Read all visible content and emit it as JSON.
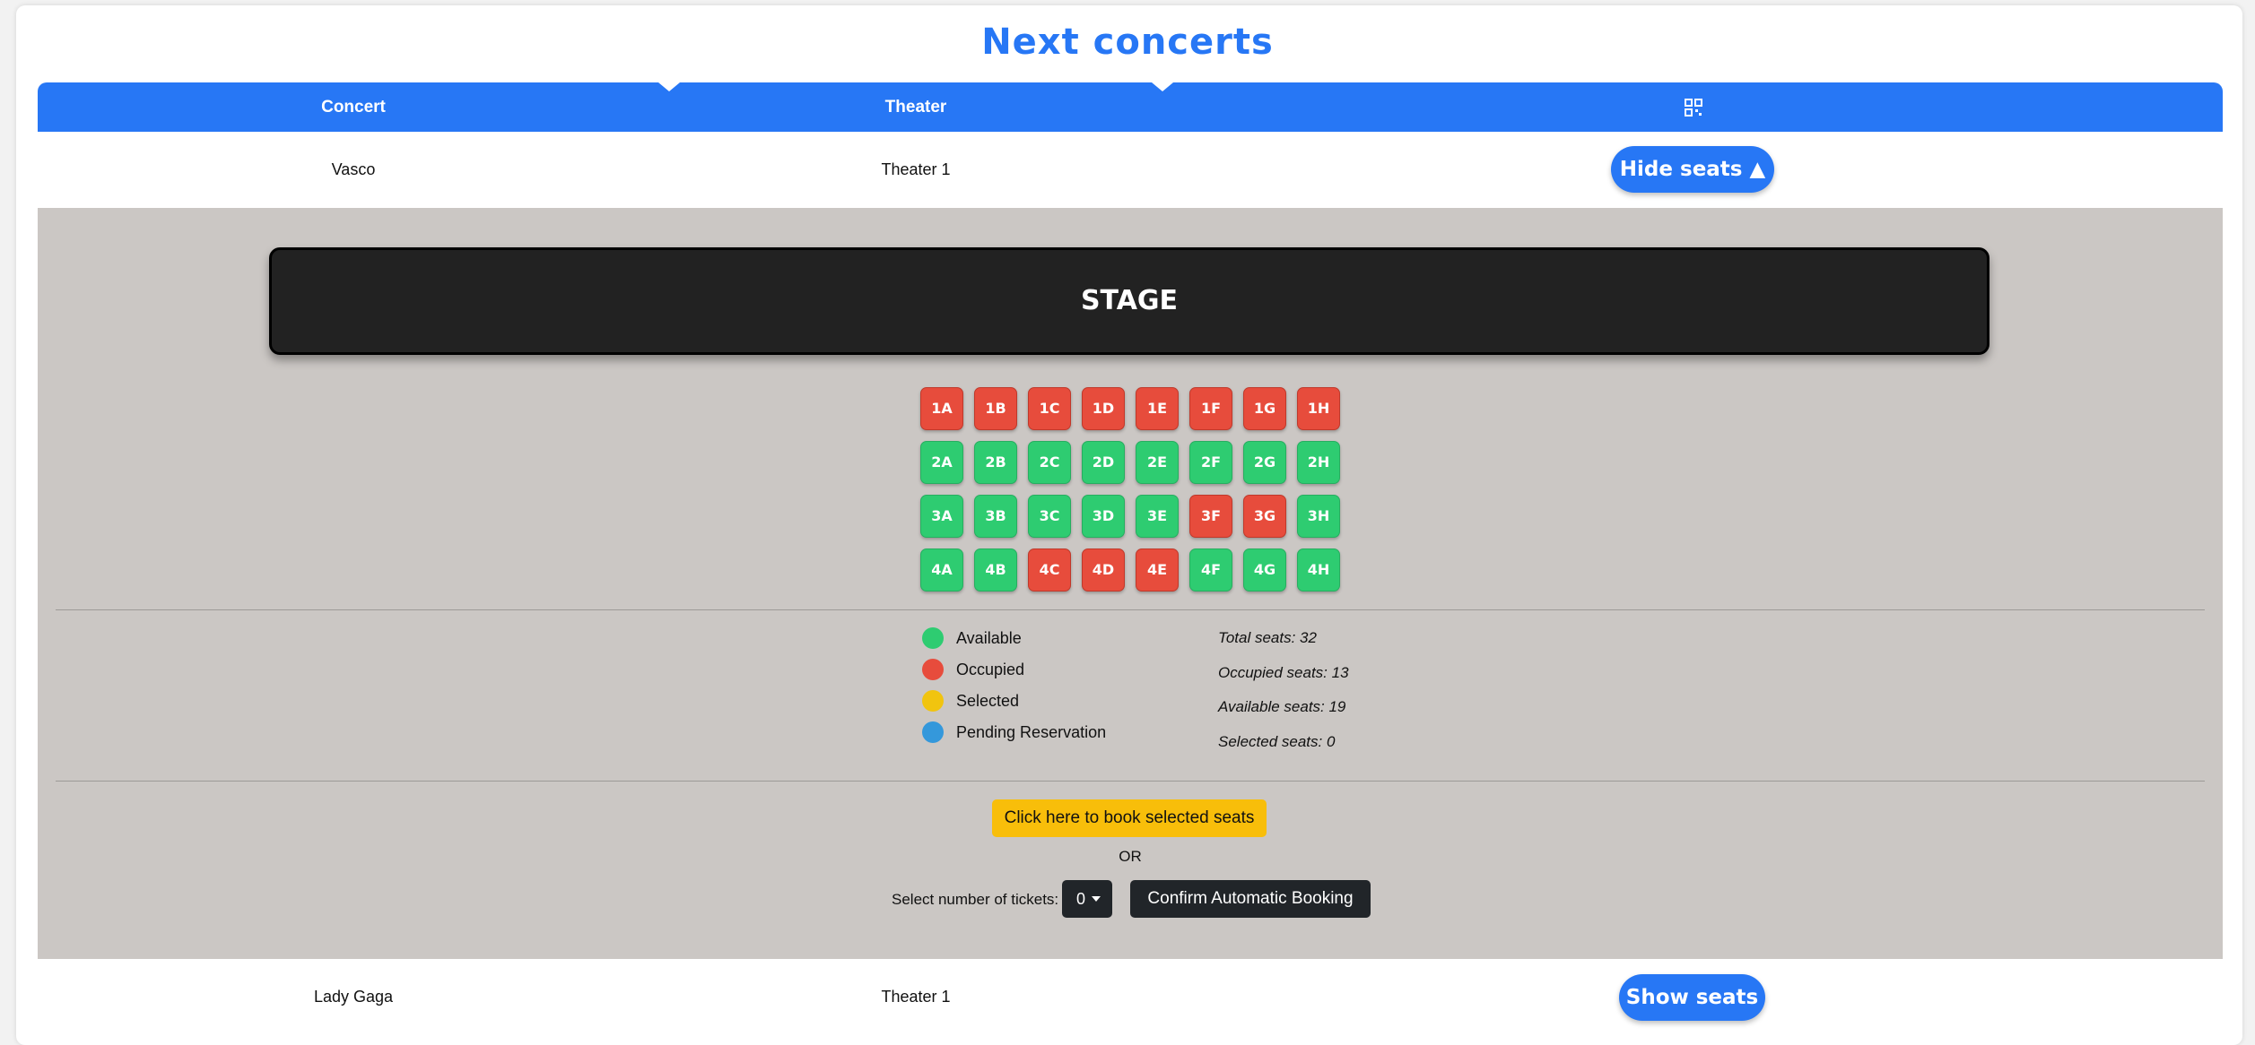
{
  "page": {
    "title": "Next concerts"
  },
  "table": {
    "headers": {
      "concert": "Concert",
      "theater": "Theater",
      "actions_icon": "grid-icon"
    },
    "rows": [
      {
        "concert": "Vasco",
        "theater": "Theater 1",
        "action": "Hide seats ▲",
        "expanded": true
      },
      {
        "concert": "Lady Gaga",
        "theater": "Theater 1",
        "action": "Show seats",
        "expanded": false
      }
    ]
  },
  "seatmap": {
    "stage_label": "STAGE",
    "rows": [
      [
        {
          "id": "1A",
          "status": "occupied"
        },
        {
          "id": "1B",
          "status": "occupied"
        },
        {
          "id": "1C",
          "status": "occupied"
        },
        {
          "id": "1D",
          "status": "occupied"
        },
        {
          "id": "1E",
          "status": "occupied"
        },
        {
          "id": "1F",
          "status": "occupied"
        },
        {
          "id": "1G",
          "status": "occupied"
        },
        {
          "id": "1H",
          "status": "occupied"
        }
      ],
      [
        {
          "id": "2A",
          "status": "available"
        },
        {
          "id": "2B",
          "status": "available"
        },
        {
          "id": "2C",
          "status": "available"
        },
        {
          "id": "2D",
          "status": "available"
        },
        {
          "id": "2E",
          "status": "available"
        },
        {
          "id": "2F",
          "status": "available"
        },
        {
          "id": "2G",
          "status": "available"
        },
        {
          "id": "2H",
          "status": "available"
        }
      ],
      [
        {
          "id": "3A",
          "status": "available"
        },
        {
          "id": "3B",
          "status": "available"
        },
        {
          "id": "3C",
          "status": "available"
        },
        {
          "id": "3D",
          "status": "available"
        },
        {
          "id": "3E",
          "status": "available"
        },
        {
          "id": "3F",
          "status": "occupied"
        },
        {
          "id": "3G",
          "status": "occupied"
        },
        {
          "id": "3H",
          "status": "available"
        }
      ],
      [
        {
          "id": "4A",
          "status": "available"
        },
        {
          "id": "4B",
          "status": "available"
        },
        {
          "id": "4C",
          "status": "occupied"
        },
        {
          "id": "4D",
          "status": "occupied"
        },
        {
          "id": "4E",
          "status": "occupied"
        },
        {
          "id": "4F",
          "status": "available"
        },
        {
          "id": "4G",
          "status": "available"
        },
        {
          "id": "4H",
          "status": "available"
        }
      ]
    ],
    "legend": [
      {
        "label": "Available",
        "color": "#2ecc71"
      },
      {
        "label": "Occupied",
        "color": "#e74c3c"
      },
      {
        "label": "Selected",
        "color": "#f1c40f"
      },
      {
        "label": "Pending Reservation",
        "color": "#3498db"
      }
    ],
    "stats": {
      "total": "Total seats: 32",
      "occupied": "Occupied seats: 13",
      "available": "Available seats: 19",
      "selected": "Selected seats: 0"
    },
    "book_button": "Click here to book selected seats",
    "or_text": "OR",
    "tickets_label": "Select number of tickets:",
    "tickets_value": "0",
    "confirm_button": "Confirm Automatic Booking"
  },
  "colors": {
    "accent": "#2777f5",
    "occupied": "#e74c3c",
    "available": "#2ecc71",
    "book": "#f8be0a",
    "dark": "#212529"
  }
}
